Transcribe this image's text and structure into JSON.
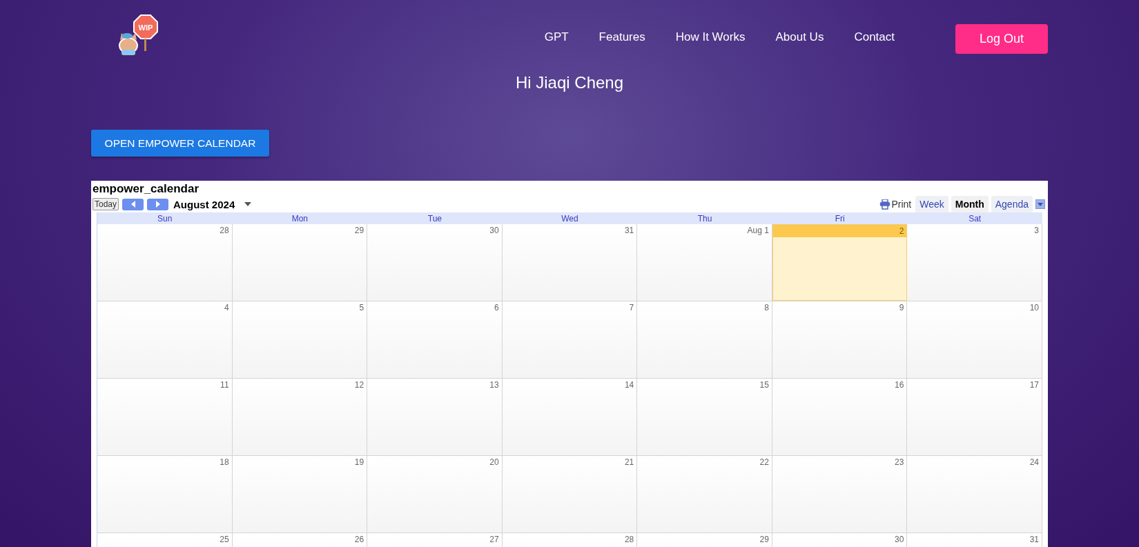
{
  "logo": {
    "sign": "WIP"
  },
  "nav": {
    "links": [
      "GPT",
      "Features",
      "How It Works",
      "About Us",
      "Contact"
    ],
    "logout": "Log Out"
  },
  "greeting": "Hi Jiaqi Cheng",
  "open_button": "OPEN EMPOWER CALENDAR",
  "calendar": {
    "title": "empower_calendar",
    "today_button": "Today",
    "month": "August 2024",
    "print": "Print",
    "views": [
      {
        "label": "Week",
        "selected": false
      },
      {
        "label": "Month",
        "selected": true
      },
      {
        "label": "Agenda",
        "selected": false
      }
    ],
    "weekdays": [
      "Sun",
      "Mon",
      "Tue",
      "Wed",
      "Thu",
      "Fri",
      "Sat"
    ],
    "weeks": [
      [
        {
          "label": "28",
          "today": false
        },
        {
          "label": "29",
          "today": false
        },
        {
          "label": "30",
          "today": false
        },
        {
          "label": "31",
          "today": false
        },
        {
          "label": "Aug 1",
          "today": false
        },
        {
          "label": "2",
          "today": true
        },
        {
          "label": "3",
          "today": false
        }
      ],
      [
        {
          "label": "4",
          "today": false
        },
        {
          "label": "5",
          "today": false
        },
        {
          "label": "6",
          "today": false
        },
        {
          "label": "7",
          "today": false
        },
        {
          "label": "8",
          "today": false
        },
        {
          "label": "9",
          "today": false
        },
        {
          "label": "10",
          "today": false
        }
      ],
      [
        {
          "label": "11",
          "today": false
        },
        {
          "label": "12",
          "today": false
        },
        {
          "label": "13",
          "today": false
        },
        {
          "label": "14",
          "today": false
        },
        {
          "label": "15",
          "today": false
        },
        {
          "label": "16",
          "today": false
        },
        {
          "label": "17",
          "today": false
        }
      ],
      [
        {
          "label": "18",
          "today": false
        },
        {
          "label": "19",
          "today": false
        },
        {
          "label": "20",
          "today": false
        },
        {
          "label": "21",
          "today": false
        },
        {
          "label": "22",
          "today": false
        },
        {
          "label": "23",
          "today": false
        },
        {
          "label": "24",
          "today": false
        }
      ],
      [
        {
          "label": "25",
          "today": false
        },
        {
          "label": "26",
          "today": false
        },
        {
          "label": "27",
          "today": false
        },
        {
          "label": "28",
          "today": false
        },
        {
          "label": "29",
          "today": false
        },
        {
          "label": "30",
          "today": false
        },
        {
          "label": "31",
          "today": false
        }
      ]
    ]
  }
}
